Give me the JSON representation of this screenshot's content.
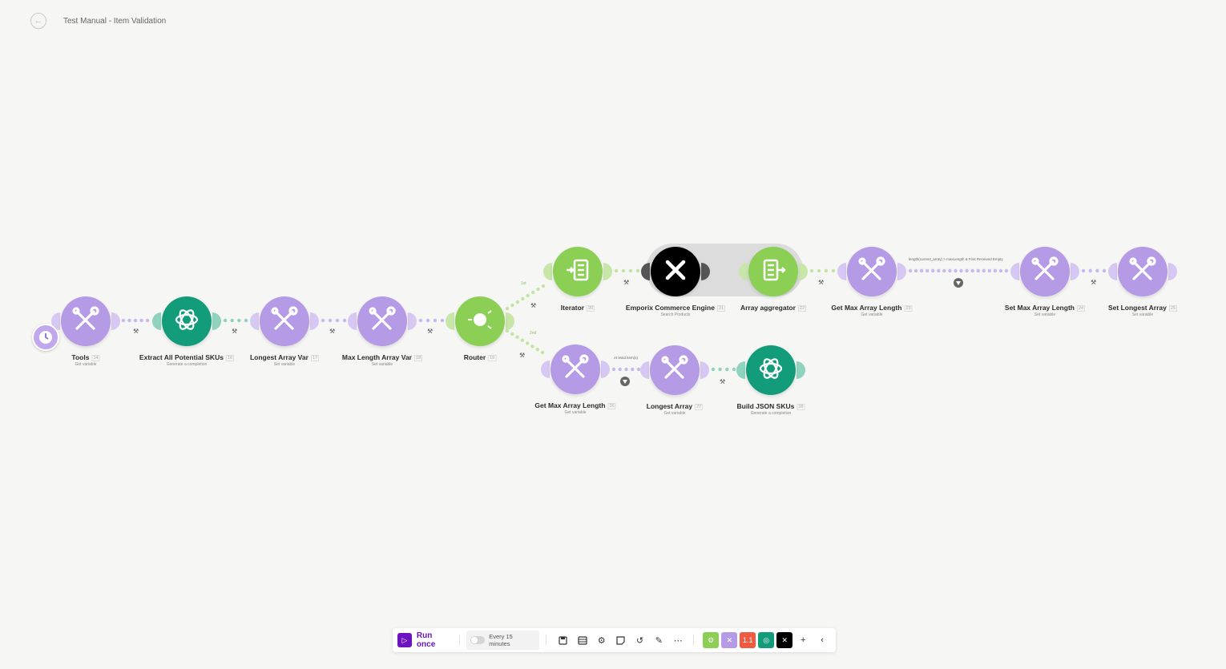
{
  "header": {
    "title": "Test Manual - Item Validation",
    "back_icon": "arrow-left-icon"
  },
  "colors": {
    "purple": "#b59ae6",
    "teal": "#129c79",
    "green": "#8ccf55",
    "black": "#000000",
    "accent": "#6d13c2"
  },
  "nodes": [
    {
      "id": "tools",
      "title": "Tools",
      "num": "14",
      "subtitle": "Get variable",
      "app": "tools",
      "has_clock": true
    },
    {
      "id": "extract",
      "title": "Extract All Potential SKUs",
      "num": "16",
      "subtitle": "Generate a completion",
      "app": "openai"
    },
    {
      "id": "longest-var",
      "title": "Longest Array Var",
      "num": "17",
      "subtitle": "Set variable",
      "app": "tools"
    },
    {
      "id": "maxlen-var",
      "title": "Max Length Array Var",
      "num": "18",
      "subtitle": "Set variable",
      "app": "tools"
    },
    {
      "id": "router",
      "title": "Router",
      "num": "19",
      "subtitle": "",
      "app": "router"
    },
    {
      "id": "iterator",
      "title": "Iterator",
      "num": "20",
      "subtitle": "",
      "app": "iterator"
    },
    {
      "id": "emporix",
      "title": "Emporix Commerce Engine",
      "num": "21",
      "subtitle": "Search Products",
      "app": "emporix"
    },
    {
      "id": "aggregator",
      "title": "Array aggregator",
      "num": "22",
      "subtitle": "",
      "app": "aggregator"
    },
    {
      "id": "get-max-1",
      "title": "Get Max Array Length",
      "num": "23",
      "subtitle": "Get variable",
      "app": "tools"
    },
    {
      "id": "set-max",
      "title": "Set Max Array Length",
      "num": "24",
      "subtitle": "Set variable",
      "app": "tools"
    },
    {
      "id": "set-longest",
      "title": "Set Longest Array",
      "num": "25",
      "subtitle": "Set variable",
      "app": "tools"
    },
    {
      "id": "get-max-2",
      "title": "Get Max Array Length",
      "num": "26",
      "subtitle": "Get variable",
      "app": "tools"
    },
    {
      "id": "longest-array",
      "title": "Longest Array",
      "num": "27",
      "subtitle": "Get variable",
      "app": "tools"
    },
    {
      "id": "build-json",
      "title": "Build JSON SKUs",
      "num": "28",
      "subtitle": "Generate a completion",
      "app": "openai"
    }
  ],
  "filters": {
    "top": "length(current_array) > maxLength & First Received Empty",
    "bottom": "At least item(s)"
  },
  "routes": {
    "r1": "1st",
    "r2": "2nd"
  },
  "toolbar": {
    "run_label": "Run once",
    "schedule_label": "Every 15 minutes",
    "icons": [
      "save-icon",
      "scenario-settings-icon",
      "gear-icon",
      "notes-icon",
      "undo-icon",
      "auto-align-icon",
      "more-icon"
    ],
    "chips": [
      {
        "name": "tools-app-chip",
        "color": "#8ccf55",
        "glyph": "⚙"
      },
      {
        "name": "tools2-app-chip",
        "color": "#b59ae6",
        "glyph": "✕"
      },
      {
        "name": "counter-app-chip",
        "color": "#ef5a41",
        "glyph": "1.1"
      },
      {
        "name": "openai-app-chip",
        "color": "#129c79",
        "glyph": "◎"
      },
      {
        "name": "emporix-app-chip",
        "color": "#000000",
        "glyph": "✕"
      }
    ],
    "add_label": "+",
    "collapse_label": "‹"
  }
}
